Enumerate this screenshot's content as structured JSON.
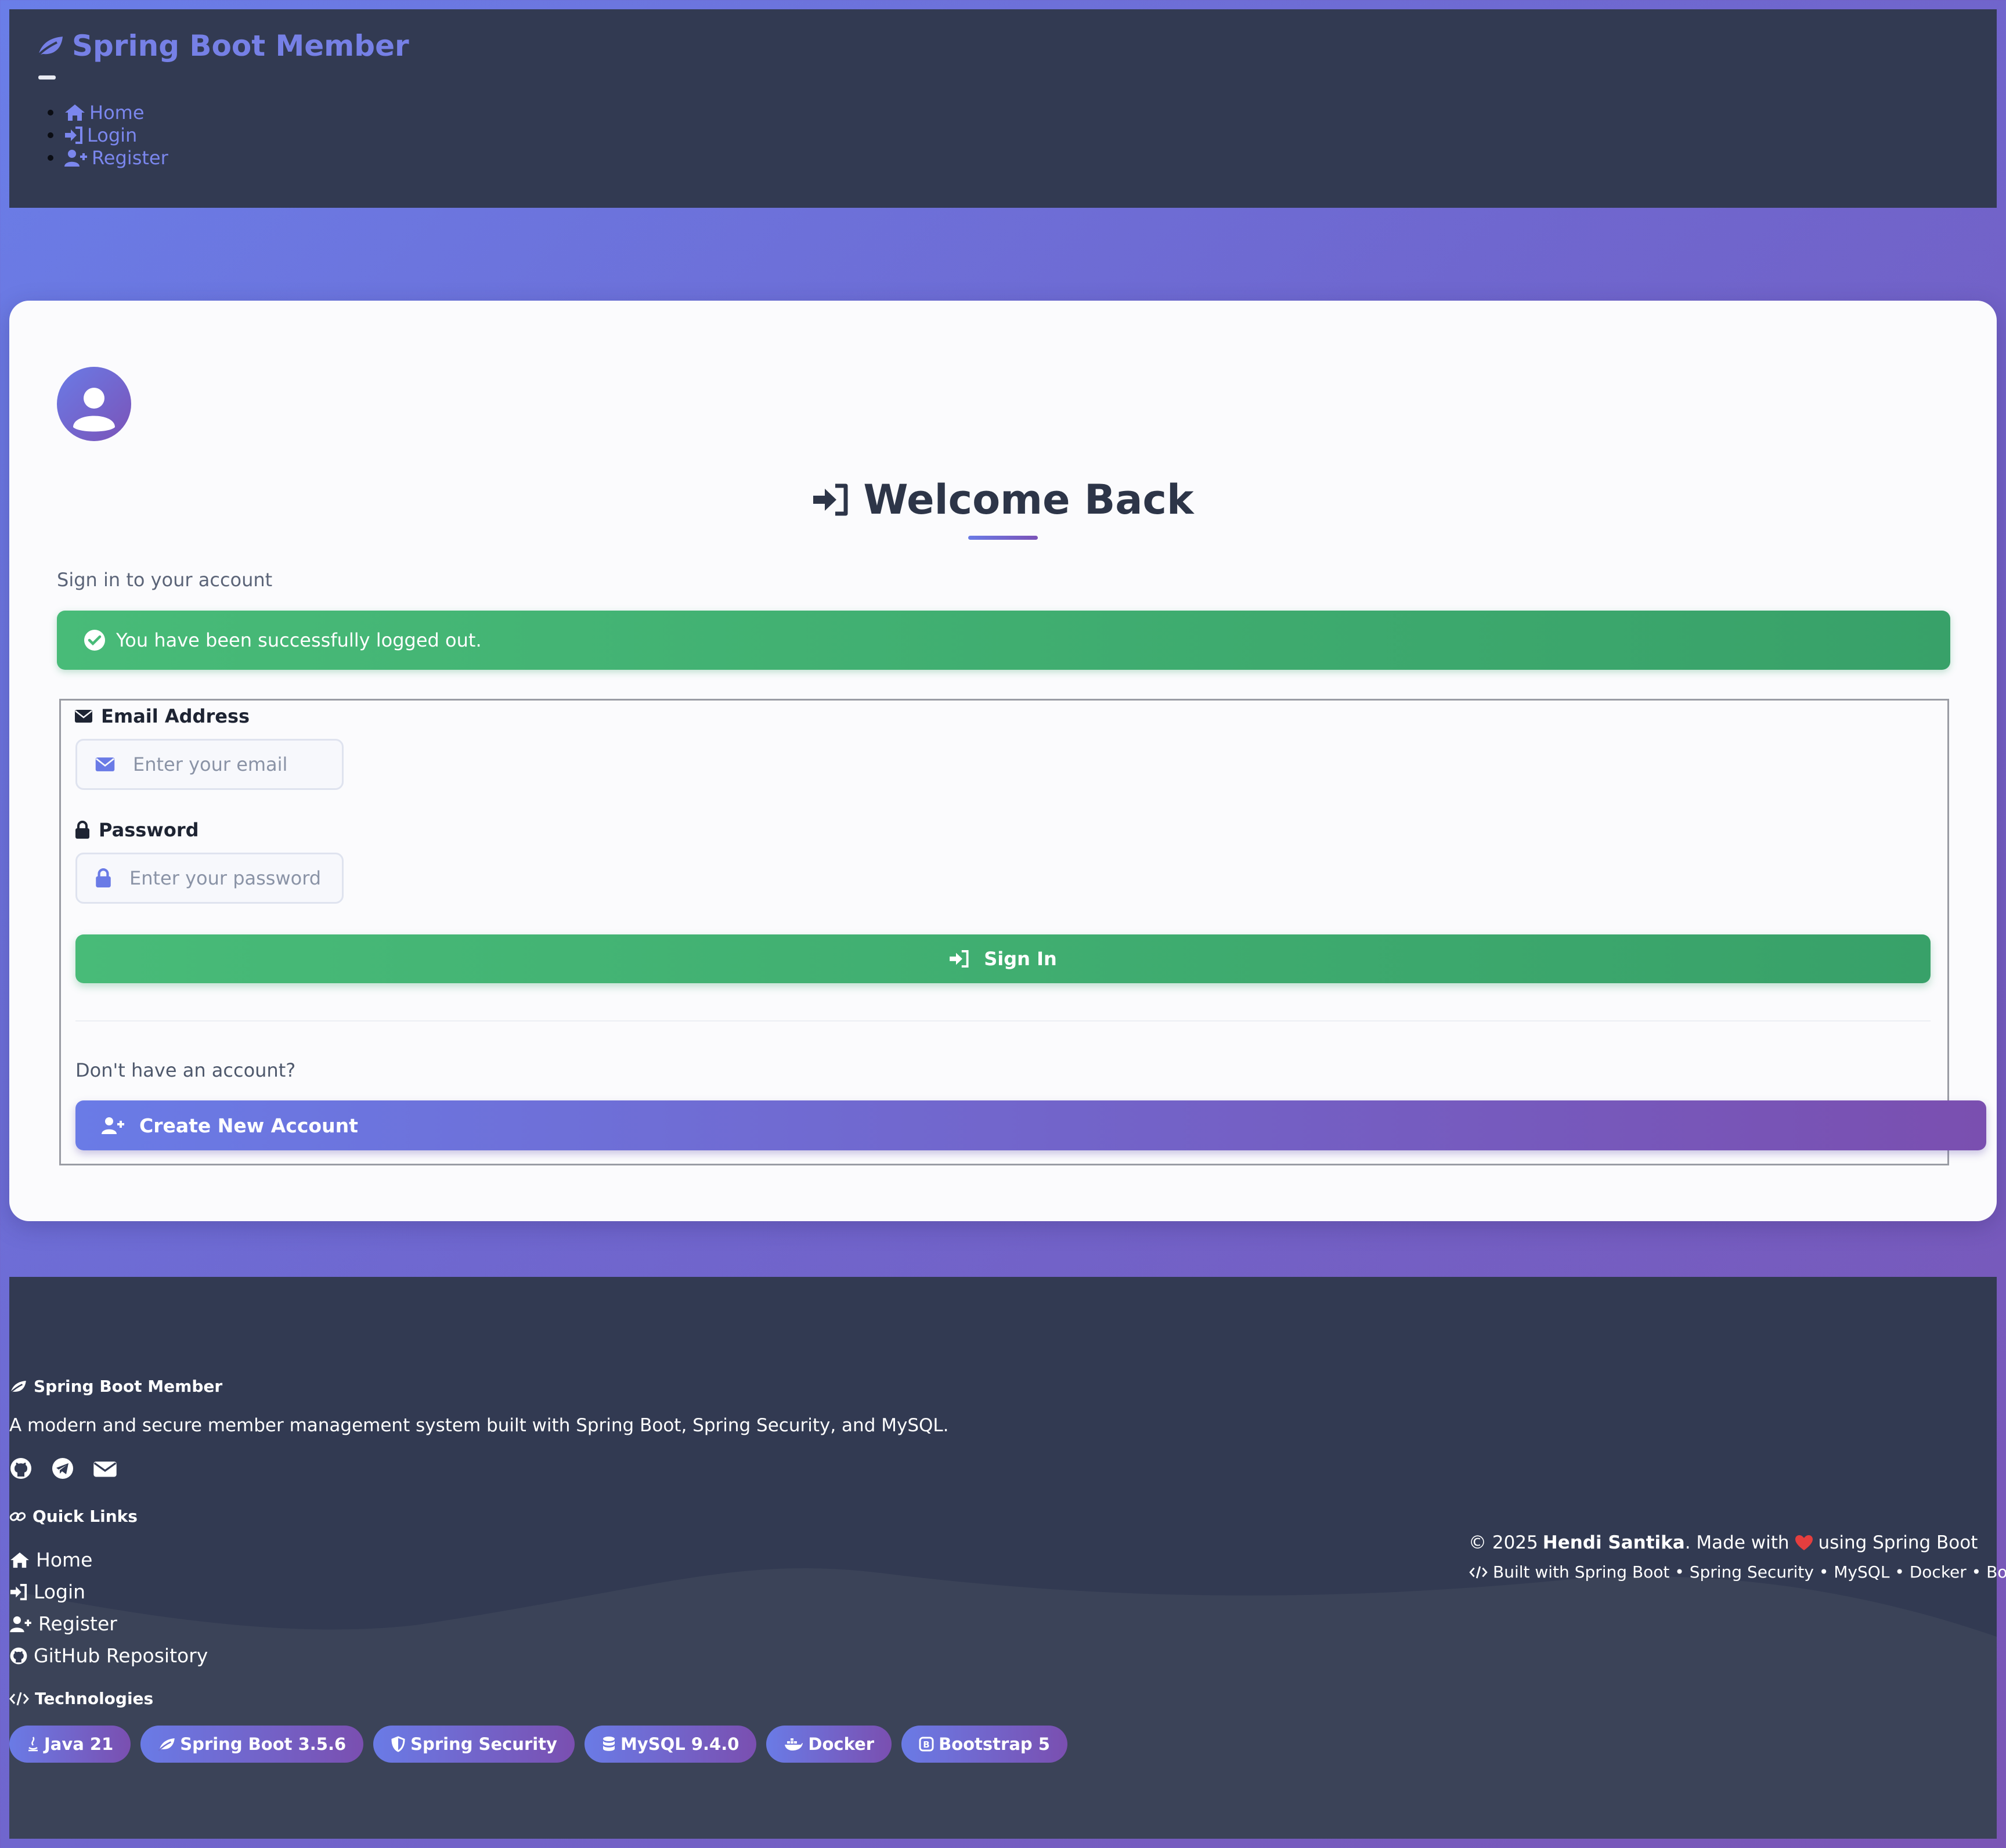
{
  "header": {
    "brand": "Spring Boot Member",
    "nav": [
      {
        "label": "Home",
        "icon": "home-icon"
      },
      {
        "label": "Login",
        "icon": "login-icon"
      },
      {
        "label": "Register",
        "icon": "user-plus-icon"
      }
    ]
  },
  "login": {
    "title": "Welcome Back",
    "subtitle": "Sign in to your account",
    "alert": "You have been successfully logged out.",
    "email_label": "Email Address",
    "email_placeholder": "Enter your email",
    "password_label": "Password",
    "password_placeholder": "Enter your password",
    "signin_label": "Sign In",
    "no_account": "Don't have an account?",
    "create_label": "Create New Account"
  },
  "footer": {
    "brand": "Spring Boot Member",
    "description": "A modern and secure member management system built with Spring Boot, Spring Security, and MySQL.",
    "social": [
      "github-icon",
      "telegram-icon",
      "envelope-icon"
    ],
    "quick_links_title": "Quick Links",
    "quick_links": [
      "Home",
      "Login",
      "Register",
      "GitHub Repository"
    ],
    "tech_title": "Technologies",
    "technologies": [
      "Java 21",
      "Spring Boot 3.5.6",
      "Spring Security",
      "MySQL 9.4.0",
      "Docker",
      "Bootstrap 5"
    ],
    "copyright_prefix": "© 2025",
    "author": "Hendi Santika",
    "made_with": ". Made with",
    "made_suffix": "using Spring Boot",
    "built_with": "Built with Spring Boot • Spring Security • MySQL • Docker • Bootstrap"
  },
  "colors": {
    "accent": "#6a7be6",
    "accent_end": "#7b53b8",
    "success": "#48bb78",
    "header_bg": "#323a52",
    "heart": "#e53e3e"
  }
}
